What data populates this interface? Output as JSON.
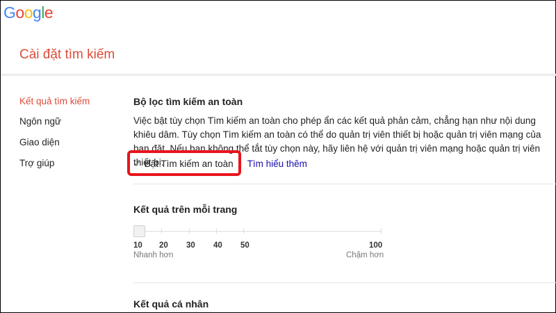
{
  "header": {
    "logo": "Google",
    "title": "Cài đặt tìm kiếm"
  },
  "sidebar": {
    "items": [
      {
        "label": "Kết quả tìm kiếm"
      },
      {
        "label": "Ngôn ngữ"
      },
      {
        "label": "Giao diện"
      },
      {
        "label": "Trợ giúp"
      }
    ]
  },
  "safe_search": {
    "heading": "Bộ lọc tìm kiếm an toàn",
    "description": "Việc bật tùy chọn Tìm kiếm an toàn cho phép ẩn các kết quả phản cảm, chẳng hạn như nội dung khiêu dâm. Tùy chọn Tìm kiếm an toàn có thể do quản trị viên thiết bị hoặc quản trị viên mạng của bạn đặt. Nếu bạn không thể tắt tùy chọn này, hãy liên hệ với quản trị viên mạng hoặc quản trị viên thiết bị.",
    "checkbox_label": "Bật Tìm kiếm an toàn",
    "checked": true,
    "learn_more": "Tìm hiểu thêm"
  },
  "results_per_page": {
    "heading": "Kết quả trên mỗi trang",
    "ticks": [
      "10",
      "20",
      "30",
      "40",
      "50",
      "100"
    ],
    "value": 10,
    "faster": "Nhanh hơn",
    "slower": "Chậm hơn"
  },
  "personal": {
    "heading": "Kết quả cá nhân"
  },
  "colors": {
    "accent": "#dd4b39",
    "link": "#1a0dab",
    "highlight": "#e8141c"
  }
}
